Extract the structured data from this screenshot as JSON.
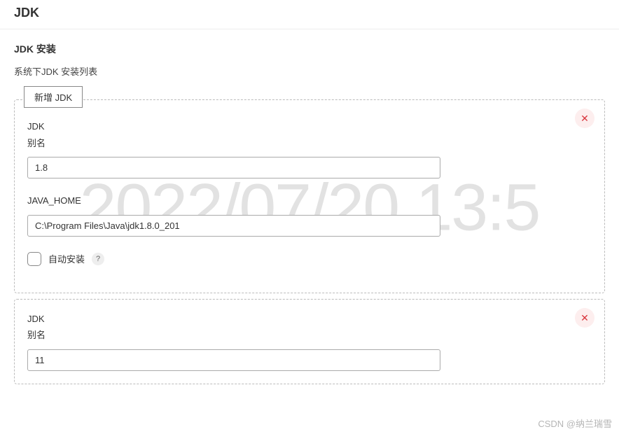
{
  "page": {
    "title": "JDK"
  },
  "section": {
    "heading": "JDK 安装",
    "description": "系统下JDK 安装列表",
    "add_button": "新增 JDK"
  },
  "jdk_entries": [
    {
      "alias_label_line1": "JDK",
      "alias_label_line2": "别名",
      "alias_value": "1.8",
      "java_home_label": "JAVA_HOME",
      "java_home_value": "C:\\Program Files\\Java\\jdk1.8.0_201",
      "auto_install_label": "自动安装",
      "auto_install_checked": false
    },
    {
      "alias_label_line1": "JDK",
      "alias_label_line2": "别名",
      "alias_value": "11"
    }
  ],
  "watermark": "2022/07/20 13:5",
  "attribution": "CSDN @纳兰瑞雪"
}
